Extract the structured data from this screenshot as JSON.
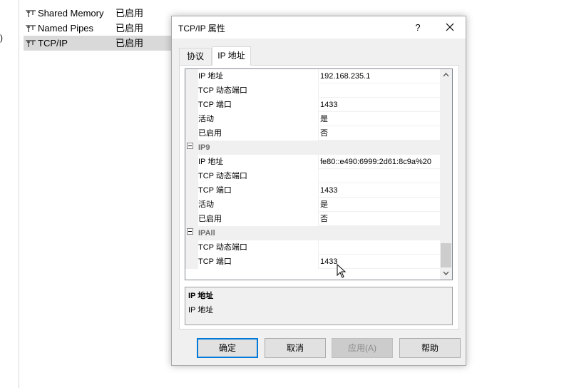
{
  "background": {
    "left_paren": ")",
    "protocols": [
      {
        "name": "Shared Memory",
        "status": "已启用"
      },
      {
        "name": "Named Pipes",
        "status": "已启用"
      },
      {
        "name": "TCP/IP",
        "status": "已启用"
      }
    ]
  },
  "dialog": {
    "title": "TCP/IP 属性",
    "help_glyph": "?",
    "tabs": [
      {
        "label": "协议"
      },
      {
        "label": "IP 地址"
      }
    ],
    "grid_rows": [
      {
        "type": "prop",
        "name": "IP 地址",
        "value": "192.168.235.1"
      },
      {
        "type": "prop",
        "name": "TCP 动态端口",
        "value": ""
      },
      {
        "type": "prop",
        "name": "TCP 端口",
        "value": "1433"
      },
      {
        "type": "prop",
        "name": "活动",
        "value": "是"
      },
      {
        "type": "prop",
        "name": "已启用",
        "value": "否"
      },
      {
        "type": "cat",
        "name": "IP9",
        "value": ""
      },
      {
        "type": "prop",
        "name": "IP 地址",
        "value": "fe80::e490:6999:2d61:8c9a%20"
      },
      {
        "type": "prop",
        "name": "TCP 动态端口",
        "value": ""
      },
      {
        "type": "prop",
        "name": "TCP 端口",
        "value": "1433"
      },
      {
        "type": "prop",
        "name": "活动",
        "value": "是"
      },
      {
        "type": "prop",
        "name": "已启用",
        "value": "否"
      },
      {
        "type": "cat",
        "name": "IPAll",
        "value": ""
      },
      {
        "type": "prop",
        "name": "TCP 动态端口",
        "value": ""
      },
      {
        "type": "prop",
        "name": "TCP 端口",
        "value": "1433"
      }
    ],
    "description": {
      "title": "IP 地址",
      "text": "IP 地址"
    },
    "buttons": {
      "ok": "确定",
      "cancel": "取消",
      "apply": "应用(A)",
      "help": "帮助"
    }
  },
  "colors": {
    "accent": "#0078d7",
    "panel": "#f0f0f0",
    "category_text": "#6d6d6d"
  }
}
